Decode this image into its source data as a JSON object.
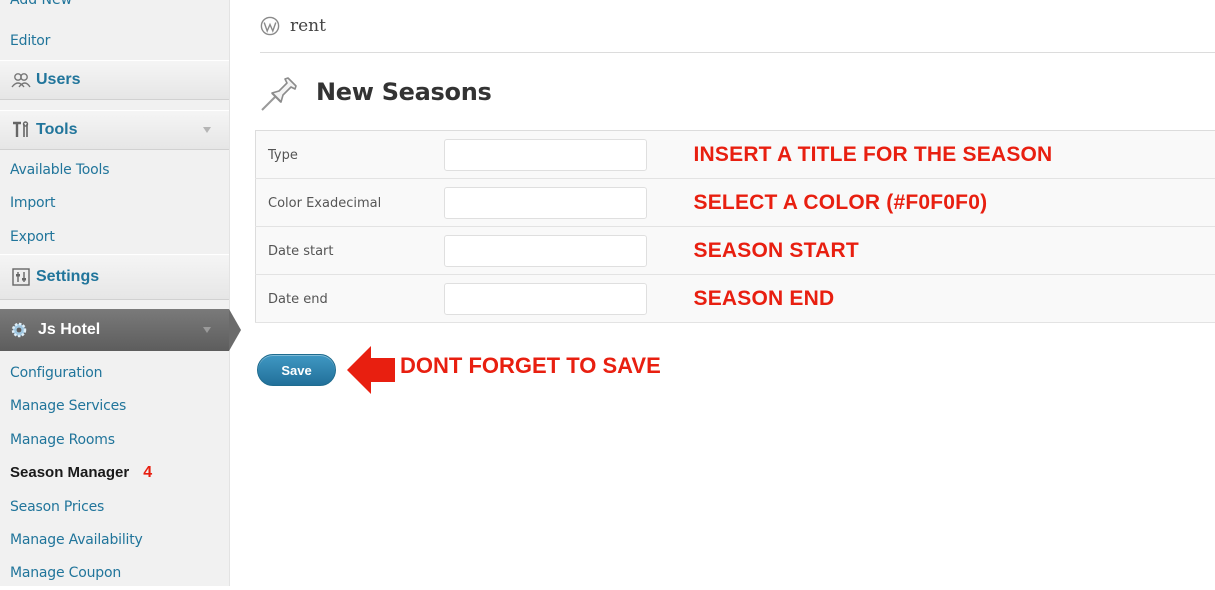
{
  "sidebar": {
    "cut_item": "Add New",
    "editor": "Editor",
    "users": "Users",
    "tools": "Tools",
    "tools_items": [
      "Available Tools",
      "Import",
      "Export"
    ],
    "settings": "Settings",
    "plugin_menu": "Js Hotel",
    "plugin_items": [
      "Configuration",
      "Manage Services",
      "Manage Rooms",
      "Season Manager",
      "Season Prices",
      "Manage Availability",
      "Manage Coupon"
    ],
    "current_step": "4"
  },
  "site": {
    "name": "rent"
  },
  "page": {
    "title": "New Seasons"
  },
  "form": {
    "rows": [
      {
        "label": "Type",
        "value": "",
        "hint": "INSERT A TITLE FOR THE SEASON"
      },
      {
        "label": "Color Exadecimal",
        "value": "",
        "hint": "SELECT A COLOR (#F0F0F0)"
      },
      {
        "label": "Date start",
        "value": "",
        "hint": "SEASON START"
      },
      {
        "label": "Date end",
        "value": "",
        "hint": "SEASON END"
      }
    ],
    "save_label": "Save",
    "save_hint": "DONT FORGET TO SAVE"
  },
  "colors": {
    "link": "#21759b",
    "annotation": "#e81f10",
    "button": "#2a7fab",
    "active_menu": "#6b6b6b"
  },
  "icons": {
    "users": "users-icon",
    "tools": "tools-icon",
    "settings": "settings-icon",
    "plugin": "gear-icon",
    "site": "wordpress-logo-icon",
    "page": "pushpin-icon",
    "annotation": "red-arrow-icon"
  }
}
